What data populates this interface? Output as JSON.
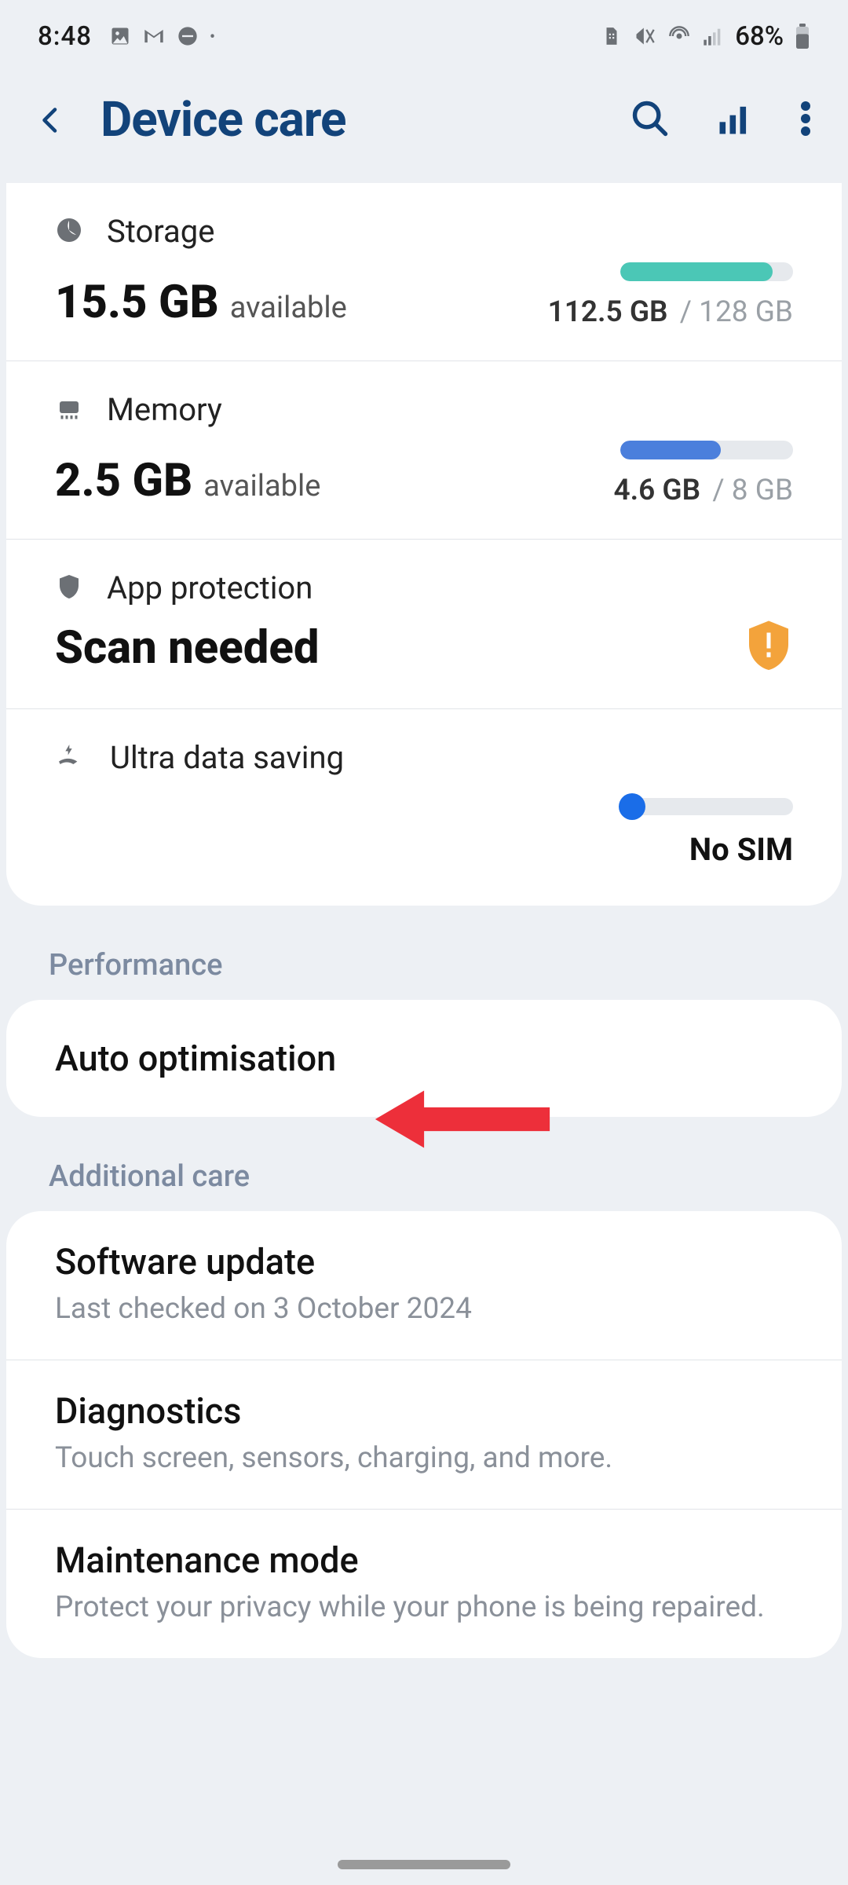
{
  "statusbar": {
    "time": "8:48",
    "battery_text": "68%"
  },
  "header": {
    "title": "Device care"
  },
  "storage": {
    "label": "Storage",
    "big": "15.5 GB",
    "avail": "available",
    "used": "112.5 GB",
    "total": "128 GB",
    "fill_pct": 88
  },
  "memory": {
    "label": "Memory",
    "big": "2.5 GB",
    "avail": "available",
    "used": "4.6 GB",
    "total": "8 GB",
    "fill_pct": 58
  },
  "protection": {
    "label": "App protection",
    "status": "Scan needed"
  },
  "ultra": {
    "label": "Ultra data saving",
    "status": "No SIM"
  },
  "sections": {
    "performance": "Performance",
    "additional": "Additional care"
  },
  "performance": {
    "auto_opt": "Auto optimisation"
  },
  "additional": {
    "sw_update": {
      "title": "Software update",
      "sub": "Last checked on 3 October 2024"
    },
    "diagnostics": {
      "title": "Diagnostics",
      "sub": "Touch screen, sensors, charging, and more."
    },
    "maintenance": {
      "title": "Maintenance mode",
      "sub": "Protect your privacy while your phone is being repaired."
    }
  },
  "chart_data": [
    {
      "type": "bar",
      "categories": [
        "used"
      ],
      "values": [
        112.5
      ],
      "ylim": [
        0,
        128
      ],
      "title": "Storage (GB)"
    },
    {
      "type": "bar",
      "categories": [
        "used"
      ],
      "values": [
        4.6
      ],
      "ylim": [
        0,
        8
      ],
      "title": "Memory (GB)"
    }
  ]
}
